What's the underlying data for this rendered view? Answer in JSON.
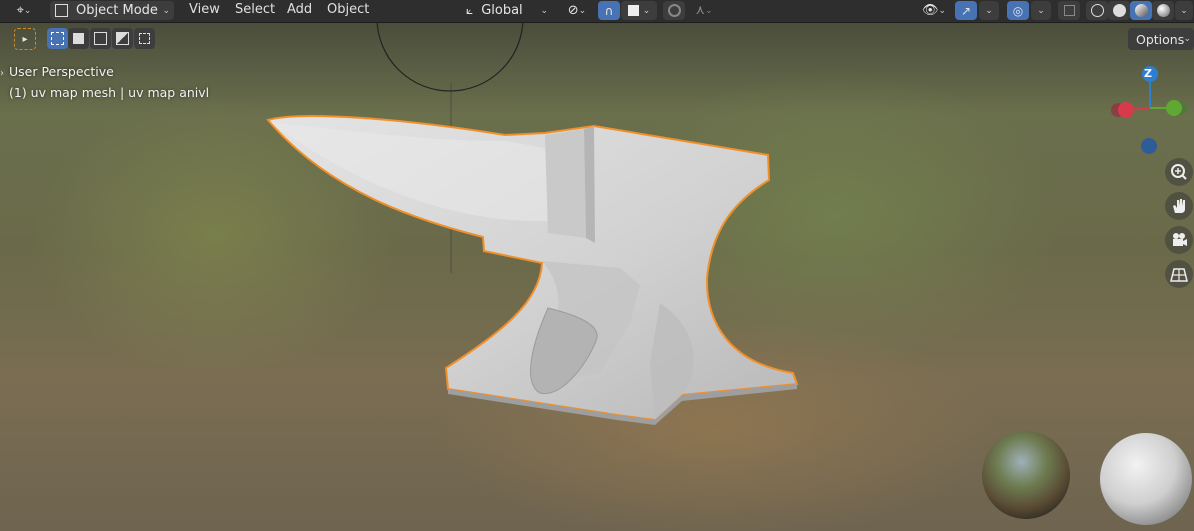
{
  "header": {
    "mode": "Object Mode",
    "menus": [
      "View",
      "Select",
      "Add",
      "Object"
    ],
    "transform_orientation": "Global"
  },
  "toolbar": {
    "options_label": "Options"
  },
  "viewport": {
    "perspective_label": "User Perspective",
    "object_label": "(1) uv map mesh | uv map anivl"
  },
  "gizmo": {
    "z_label": "Z",
    "colors": {
      "x": "#d63a4b",
      "y": "#5fa832",
      "z": "#2f7fd1",
      "neg": "#2e5c98"
    }
  },
  "icons": {
    "header": [
      "editor-type-icon",
      "object-mode-icon",
      "transform-orientation-icon",
      "pivot-icon",
      "snap-icon",
      "snap-increment-icon",
      "proportional-edit-icon",
      "proportional-falloff-icon",
      "visibility-icon",
      "gizmo-icon",
      "overlay-icon",
      "xray-icon",
      "wireframe-shading-icon",
      "solid-shading-icon",
      "material-shading-icon",
      "rendered-shading-icon"
    ],
    "nav": [
      "zoom-icon",
      "pan-hand-icon",
      "camera-icon",
      "ortho-grid-icon"
    ]
  },
  "colors": {
    "accent_blue": "#4772b3",
    "selection_outline": "#f0902a",
    "header_bg": "#2e2e2e"
  }
}
